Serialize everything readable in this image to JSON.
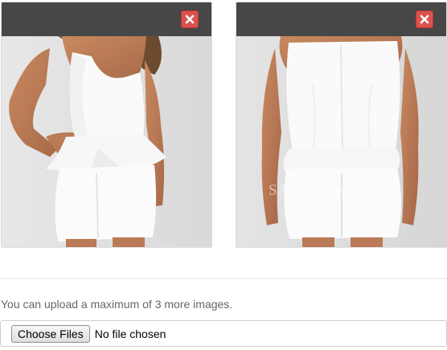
{
  "images": [
    {
      "id_label": "",
      "alt": "white peplum dress front view"
    },
    {
      "alt": "white peplum dress back view",
      "watermark": "SAMAYdress"
    }
  ],
  "upload": {
    "hint": "You can upload a maximum of 3 more images.",
    "choose_label": "Choose Files",
    "status": "No file chosen"
  },
  "colors": {
    "header": "#474747",
    "remove": "#d9534f",
    "hint_text": "#666666"
  },
  "icons": {
    "remove": "close-icon"
  }
}
